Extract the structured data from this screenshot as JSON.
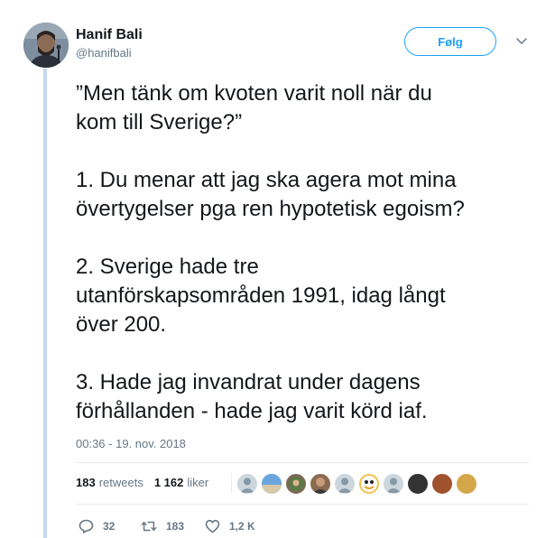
{
  "tweet": {
    "display_name": "Hanif Bali",
    "handle": "@hanifbali",
    "follow_label": "Følg",
    "paragraphs": [
      "”Men tänk om kvoten varit noll när du\nkom till Sverige?”",
      "1. Du menar att jag ska agera mot mina\növertygelser pga ren hypotetisk egoism?",
      "2. Sverige hade tre\nutanförskapsområden 1991, idag långt\növer 200.",
      "3. Hade jag invandrat under dagens\nförhållanden - hade jag varit körd iaf."
    ],
    "timestamp": "00:36 - 19. nov. 2018"
  },
  "stats": {
    "retweets_count": "183",
    "retweets_label": "retweets",
    "likes_count": "1 162",
    "likes_label": "liker"
  },
  "likers": [
    {
      "name": "default-avatar",
      "color": "#ccd6dd"
    },
    {
      "name": "landscape-avatar",
      "color": "#5b8fc7"
    },
    {
      "name": "photo-avatar",
      "color": "#7a6a55"
    },
    {
      "name": "person-avatar",
      "color": "#8b6a50"
    },
    {
      "name": "default-avatar",
      "color": "#ccd6dd"
    },
    {
      "name": "cartoon-avatar",
      "color": "#f2c14e"
    },
    {
      "name": "default-avatar",
      "color": "#ccd6dd"
    },
    {
      "name": "dark-avatar",
      "color": "#333333"
    },
    {
      "name": "brown-avatar",
      "color": "#a0522d"
    },
    {
      "name": "gold-avatar",
      "color": "#d4a84a"
    }
  ],
  "actions": {
    "reply_count": "32",
    "retweet_count": "183",
    "like_count": "1,2 K"
  },
  "colors": {
    "accent": "#1da1f2",
    "thread_line": "#c4d9ef",
    "secondary_text": "#657786"
  },
  "icons": {
    "caret": "chevron-down-icon",
    "reply": "reply-icon",
    "retweet": "retweet-icon",
    "like": "heart-icon"
  }
}
